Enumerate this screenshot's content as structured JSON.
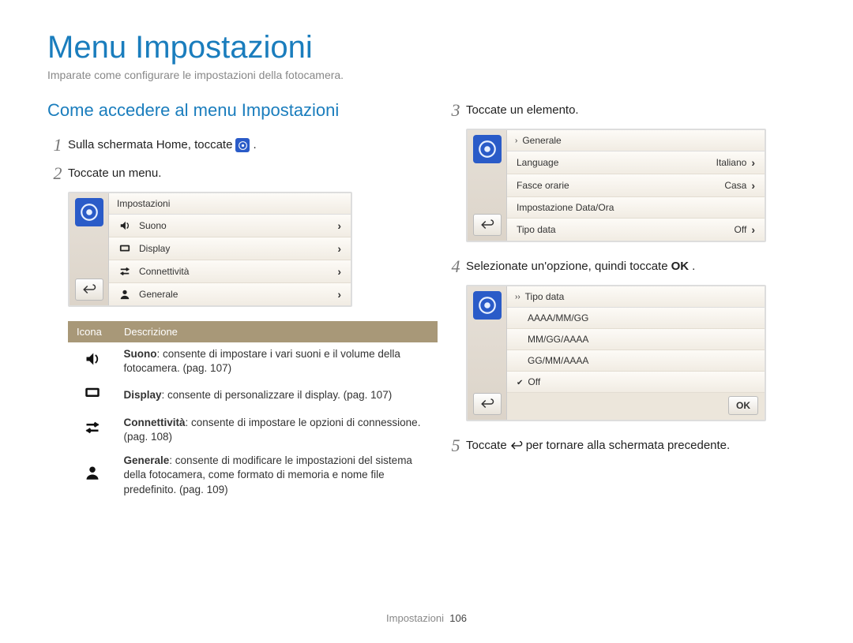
{
  "page": {
    "title": "Menu Impostazioni",
    "subtitle": "Imparate come configurare le impostazioni della fotocamera.",
    "footer_label": "Impostazioni",
    "footer_page": "106"
  },
  "left": {
    "section_title": "Come accedere al menu Impostazioni",
    "step1_pre": "Sulla schermata Home, toccate",
    "step1_post": ".",
    "step2": "Toccate un menu.",
    "device1": {
      "title": "Impostazioni",
      "items": [
        {
          "icon": "sound",
          "label": "Suono"
        },
        {
          "icon": "display",
          "label": "Display"
        },
        {
          "icon": "conn",
          "label": "Connettività"
        },
        {
          "icon": "user",
          "label": "Generale"
        }
      ]
    },
    "table": {
      "col_icon": "Icona",
      "col_desc": "Descrizione",
      "rows": [
        {
          "icon": "sound",
          "name": "Suono",
          "text": ": consente di impostare i vari suoni e il volume della fotocamera. (pag. 107)"
        },
        {
          "icon": "display",
          "name": "Display",
          "text": ": consente di personalizzare il display. (pag. 107)"
        },
        {
          "icon": "conn",
          "name": "Connettività",
          "text": ": consente di impostare le opzioni di connessione. (pag. 108)"
        },
        {
          "icon": "user",
          "name": "Generale",
          "text": ": consente di modificare le impostazioni del sistema della fotocamera, come formato di memoria e nome file predefinito. (pag. 109)"
        }
      ]
    }
  },
  "right": {
    "step3": "Toccate un elemento.",
    "device2": {
      "crumb": "Generale",
      "rows": [
        {
          "label": "Language",
          "value": "Italiano",
          "chev": true
        },
        {
          "label": "Fasce orarie",
          "value": "Casa",
          "chev": true
        },
        {
          "label": "Impostazione Data/Ora",
          "value": "",
          "chev": false
        },
        {
          "label": "Tipo data",
          "value": "Off",
          "chev": true
        }
      ]
    },
    "step4_pre": "Selezionate un'opzione, quindi toccate",
    "step4_post": ".",
    "ok_label": "OK",
    "device3": {
      "crumb": "Tipo data",
      "options": [
        "AAAA/MM/GG",
        "MM/GG/AAAA",
        "GG/MM/AAAA"
      ],
      "selected": "Off"
    },
    "step5_pre": "Toccate",
    "step5_post": "per tornare alla schermata precedente."
  }
}
